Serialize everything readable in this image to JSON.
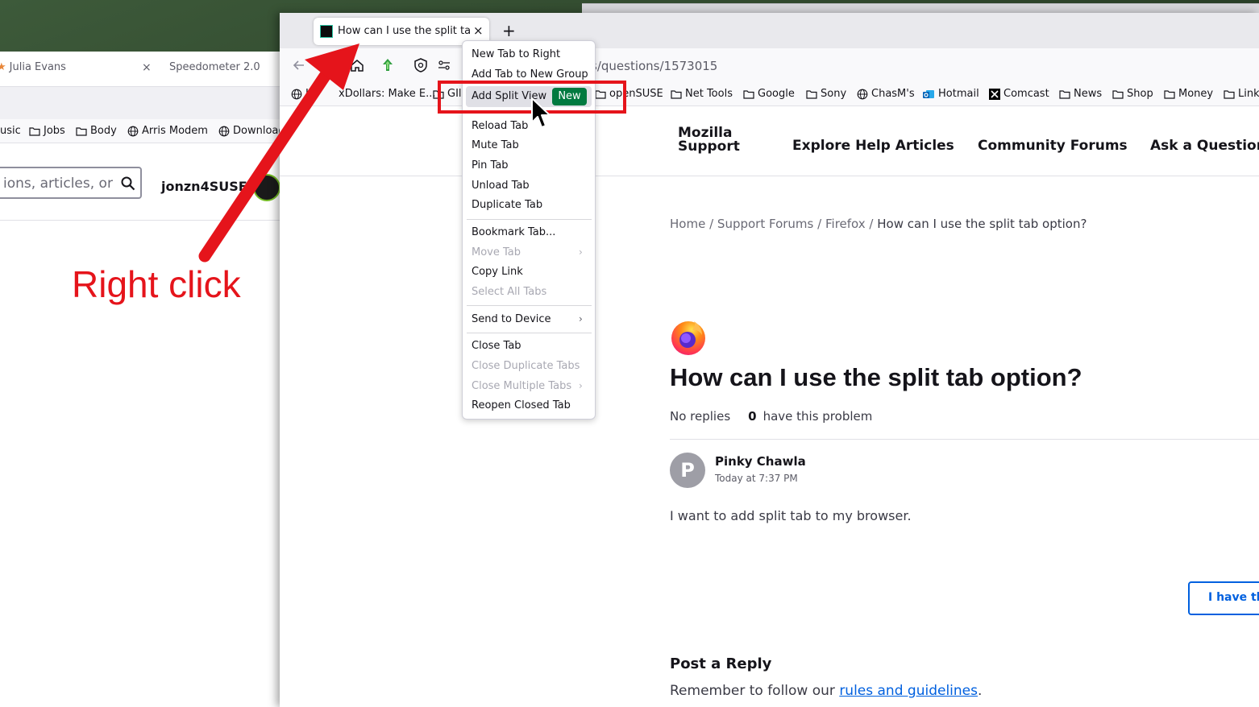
{
  "back_window": {
    "tabs": [
      {
        "label": "Julia Evans"
      },
      {
        "label": "Speedometer 2.0"
      }
    ],
    "tab_close": "×",
    "bookmarks": [
      {
        "label": "usic",
        "icon": "folder-icon"
      },
      {
        "label": "Jobs",
        "icon": "folder-icon"
      },
      {
        "label": "Body",
        "icon": "folder-icon"
      },
      {
        "label": "Arris Modem",
        "icon": "globe-icon"
      },
      {
        "label": "Download",
        "icon": "globe-icon"
      }
    ],
    "search_placeholder": "ions, articles, or",
    "username": "jonzn4SUSE"
  },
  "annotation": {
    "text": "Right click",
    "color": "#e5141b"
  },
  "main_window": {
    "active_tab": {
      "title": "How can I use the split tab option?",
      "close": "×"
    },
    "new_tab": "+",
    "url_fragment": "s/questions/1573015",
    "bookmarks": [
      {
        "label": "In",
        "icon": "globe-icon"
      },
      {
        "label": "xDollars: Make E...",
        "icon": "none"
      },
      {
        "label": "GIl",
        "icon": "folder-icon"
      },
      {
        "label": "openSUSE",
        "icon": "folder-icon"
      },
      {
        "label": "Net Tools",
        "icon": "folder-icon"
      },
      {
        "label": "Google",
        "icon": "folder-icon"
      },
      {
        "label": "Sony",
        "icon": "folder-icon"
      },
      {
        "label": "ChasM's",
        "icon": "globe-icon"
      },
      {
        "label": "Hotmail",
        "icon": "outlook-icon"
      },
      {
        "label": "Comcast",
        "icon": "x-icon"
      },
      {
        "label": "News",
        "icon": "folder-icon"
      },
      {
        "label": "Shop",
        "icon": "folder-icon"
      },
      {
        "label": "Money",
        "icon": "folder-icon"
      },
      {
        "label": "Link",
        "icon": "folder-icon"
      }
    ]
  },
  "context_menu": {
    "items": [
      {
        "label": "New Tab to Right"
      },
      {
        "label": "Add Tab to New Group"
      },
      {
        "label": "Add Split View",
        "badge": "New"
      },
      {
        "label": "Reload Tab"
      },
      {
        "label": "Mute Tab"
      },
      {
        "label": "Pin Tab"
      },
      {
        "label": "Unload Tab"
      },
      {
        "label": "Duplicate Tab"
      },
      {
        "label": "Bookmark Tab..."
      },
      {
        "label": "Move Tab",
        "disabled": true
      },
      {
        "label": "Copy Link"
      },
      {
        "label": "Select All Tabs",
        "disabled": true
      },
      {
        "label": "Send to Device"
      },
      {
        "label": "Close Tab"
      },
      {
        "label": "Close Duplicate Tabs",
        "disabled": true
      },
      {
        "label": "Close Multiple Tabs",
        "disabled": true
      },
      {
        "label": "Reopen Closed Tab"
      }
    ]
  },
  "site": {
    "logo_line1": "Mozilla",
    "logo_line2": "Support",
    "nav": [
      "Explore Help Articles",
      "Community Forums",
      "Ask a Question"
    ],
    "breadcrumb": {
      "home": "Home",
      "sep": "/",
      "forums": "Support Forums",
      "firefox": "Firefox",
      "current": "How can I use the split tab option?"
    },
    "question_title": "How can I use the split tab option?",
    "replies": "No replies",
    "problem_count": "0",
    "problem_text": "have this problem",
    "author": "Pinky Chawla",
    "author_initial": "P",
    "post_time": "Today at 7:37 PM",
    "post_body": "I want to add split tab to my browser.",
    "problem_button": "I have th",
    "reply_title": "Post a Reply",
    "reply_note_prefix": "Remember to follow our ",
    "reply_note_link": "rules and guidelines",
    "reply_note_suffix": "."
  },
  "colors": {
    "accent": "#0060df",
    "new_badge": "#017a40",
    "annotation_red": "#e5141b"
  }
}
